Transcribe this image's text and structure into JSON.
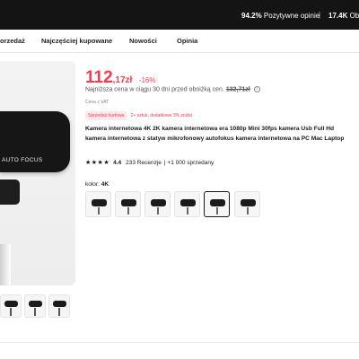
{
  "header": {
    "positive_reviews_value": "94.2%",
    "positive_reviews_label": "Pozytywne opinie",
    "separator": "|",
    "followers_value": "17.4K",
    "followers_label": "Obs"
  },
  "tabs": [
    {
      "label": "orzedaż"
    },
    {
      "label": "Najczęściej kupowane"
    },
    {
      "label": "Nowości"
    },
    {
      "label": "Opinia"
    }
  ],
  "gallery": {
    "main_image_text": "AUTO FOCUS"
  },
  "product": {
    "price_main": "112",
    "price_fraction": ",17zł",
    "discount": "-16%",
    "lowest_price_text": "Najniższa cena w ciągu 30 dni przed obniżką cen.",
    "lowest_price_value": "132,71zł",
    "vat_text": "Cena z VAT",
    "seller_badge": "Sprzedaż hurtowa",
    "seller_info": "2+ sztuk, dodatkowe 3% zniżki",
    "title": "Kamera internetowa 4K 2K kamera internetowa era 1080p Mini 30fps kamera Usb Full Hd kamera internetowa z statyw mikrofonowy autofokus kamera internetowa na PC Mac Laptop",
    "rating_stars": "★★★★",
    "rating_value": "4.4",
    "reviews": "233 Recenzje",
    "sold": "|  +1 000 sprzedany",
    "color_label_prefix": "kolor:",
    "color_label_value": "4K",
    "selected_option_index": 4
  },
  "colors": {
    "accent": "#fd384f",
    "topbar": "#141414"
  }
}
